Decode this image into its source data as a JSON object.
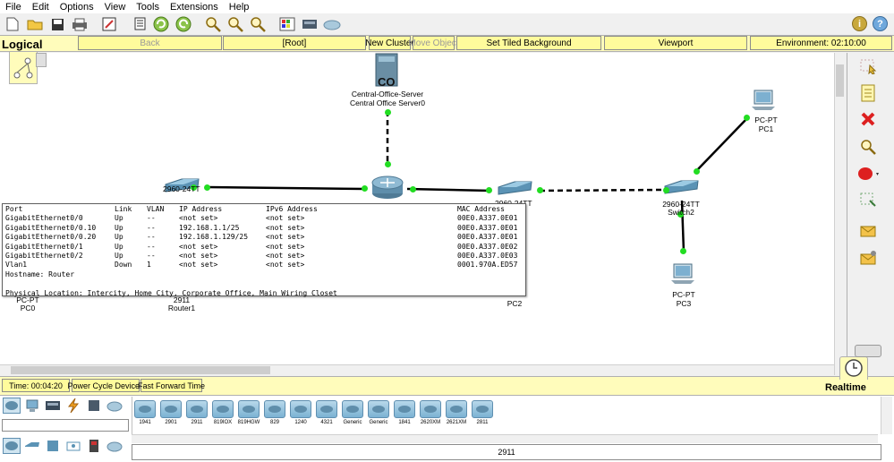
{
  "menu": [
    "File",
    "Edit",
    "Options",
    "View",
    "Tools",
    "Extensions",
    "Help"
  ],
  "toolbar_icons": [
    "new-file-icon",
    "open-folder-icon",
    "save-icon",
    "print-icon",
    "activity-wizard-icon",
    "copy-icon",
    "undo-icon",
    "redo-icon",
    "zoom-in-icon",
    "zoom-reset-icon",
    "zoom-out-icon",
    "palette-icon",
    "custom-device-icon",
    "cluster-cloud-icon"
  ],
  "logical_bar": {
    "title": "Logical",
    "back": "Back",
    "root": "[Root]",
    "new_cluster": "New Cluster",
    "move_object": "Move Object",
    "set_tiled_background": "Set Tiled Background",
    "viewport": "Viewport",
    "environment": "Environment: 02:10:00"
  },
  "devices": {
    "server": {
      "model": "Central-Office-Server",
      "name": "Central Office Server0",
      "badge": "CO"
    },
    "pc1": {
      "model": "PC-PT",
      "name": "PC1"
    },
    "pc0": {
      "model": "PC-PT",
      "name": "PC0"
    },
    "pc2": {
      "name": "PC2"
    },
    "pc3": {
      "model": "PC-PT",
      "name": "PC3"
    },
    "switch_left": {
      "model": "2960-24TT"
    },
    "switch_mid": {
      "model": "2960-24TT"
    },
    "switch2": {
      "model": "2960-24TT",
      "name": "Switch2"
    },
    "router1": {
      "model": "2911",
      "name": "Router1"
    }
  },
  "port_popup": {
    "headers": [
      "Port",
      "Link",
      "VLAN",
      "IP Address",
      "IPv6 Address",
      "MAC Address"
    ],
    "rows": [
      [
        "GigabitEthernet0/0",
        "Up",
        "--",
        "<not set>",
        "<not set>",
        "00E0.A337.0E01"
      ],
      [
        "GigabitEthernet0/0.10",
        "Up",
        "--",
        "192.168.1.1/25",
        "<not set>",
        "00E0.A337.0E01"
      ],
      [
        "GigabitEthernet0/0.20",
        "Up",
        "--",
        "192.168.1.129/25",
        "<not set>",
        "00E0.A337.0E01"
      ],
      [
        "GigabitEthernet0/1",
        "Up",
        "--",
        "<not set>",
        "<not set>",
        "00E0.A337.0E02"
      ],
      [
        "GigabitEthernet0/2",
        "Up",
        "--",
        "<not set>",
        "<not set>",
        "00E0.A337.0E03"
      ],
      [
        "Vlan1",
        "Down",
        "1",
        "<not set>",
        "<not set>",
        "0001.970A.ED57"
      ]
    ],
    "hostname": "Hostname: Router",
    "location": "Physical Location: Intercity, Home City, Corporate Office, Main Wiring Closet"
  },
  "time_bar": {
    "time": "Time: 00:04:20",
    "power_cycle": "Power Cycle Devices",
    "fast_forward": "Fast Forward Time",
    "mode": "Realtime"
  },
  "device_list": [
    "1941",
    "2901",
    "2911",
    "819IOX",
    "819HGW",
    "829",
    "1240",
    "4321",
    "Generic",
    "Generic",
    "1841",
    "2620XM",
    "2621XM",
    "2811"
  ],
  "selected_device": "2911",
  "colors": {
    "link_up": "#22dd22",
    "bar_yellow": "#fffcbb",
    "device_blue": "#7bb2d3"
  }
}
